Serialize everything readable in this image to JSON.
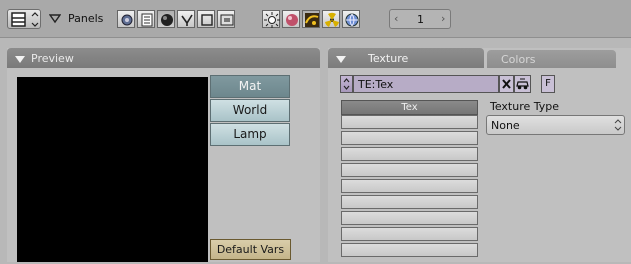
{
  "header": {
    "panels_label": "Panels",
    "frame_value": "1"
  },
  "preview": {
    "title": "Preview",
    "buttons": [
      "Mat",
      "World",
      "Lamp"
    ],
    "default_vars_label": "Default Vars"
  },
  "texture": {
    "tab_active": "Texture",
    "tab_inactive": "Colors",
    "datablock_name": "TE:Tex",
    "f_label": "F",
    "list_header": "Tex",
    "empty_rows": 9,
    "type_label": "Texture Type",
    "type_value": "None"
  },
  "icons": {
    "window_type": "window-type-icon",
    "panels_arrow": "triangle-down-icon",
    "context_buttons": [
      "shading-icon",
      "object-icon",
      "material-icon",
      "lamp-icon",
      "texture-icon",
      "world-icon"
    ]
  }
}
